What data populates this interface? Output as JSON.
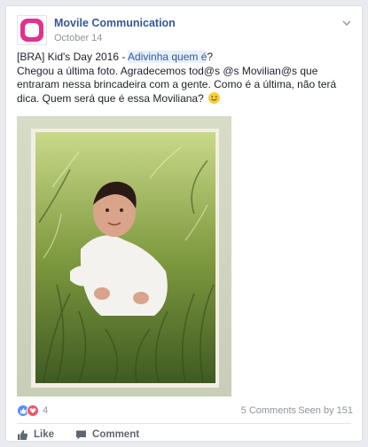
{
  "post": {
    "page_name": "Movile Communication",
    "date": "October 14",
    "text_prefix": "[BRA] Kid's Day 2016 - ",
    "text_highlight": "Adivinha quem é",
    "text_after_highlight": "?",
    "text_body": "Chegou a última foto. Agradecemos tod@s @s Movilian@s que entraram nessa brincadeira com a gente. Como é a última, não terá dica. Quem será que é essa Moviliana?",
    "avatar_icon": "movile-logo-icon",
    "brand_color": "#e2318f",
    "link_color": "#365899"
  },
  "stats": {
    "reaction_icons": [
      "like-reaction-icon",
      "love-reaction-icon"
    ],
    "reaction_count": "4",
    "comments": "5 Comments",
    "seen_by": "Seen by 151"
  },
  "actions": {
    "like_label": "Like",
    "comment_label": "Comment"
  }
}
